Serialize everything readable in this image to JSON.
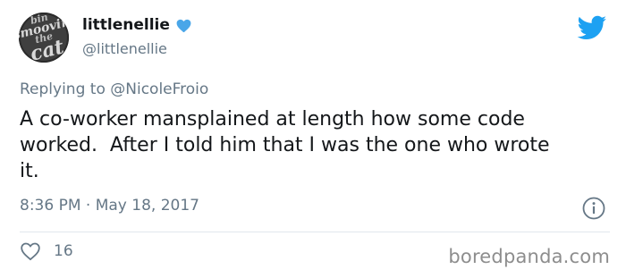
{
  "tweet": {
    "display_name": "littlenellie",
    "handle": "@littlenellie",
    "avatar_text": [
      "bin",
      "smoovin",
      "the",
      "cat"
    ],
    "reply_prefix": "Replying to ",
    "reply_to": "@NicoleFroio",
    "text": "A co-worker mansplained at length how some code\nworked.  After I told him that I was the one who wrote\nit.",
    "timestamp": "8:36 PM · May 18, 2017",
    "like_count": "16"
  },
  "icons": {
    "verified": "verified-badge-icon",
    "bird": "twitter-bird-icon",
    "info": "info-icon",
    "heart": "heart-icon"
  },
  "colors": {
    "twitter_blue": "#1da1f2",
    "verified_blue": "#4aa6e8",
    "secondary_text": "#657786",
    "primary_text": "#14171a",
    "watermark": "#8d8d8d"
  },
  "watermark": "boredpanda.com"
}
